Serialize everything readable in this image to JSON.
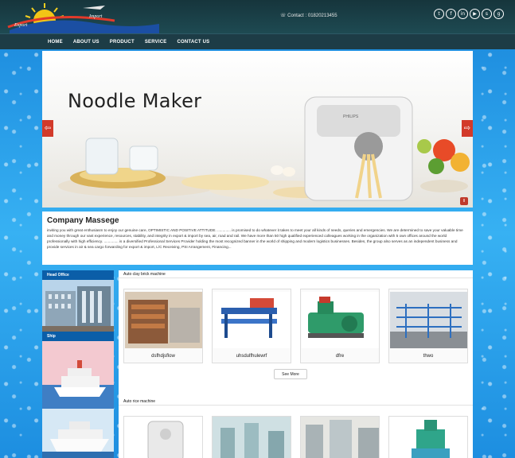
{
  "header": {
    "logo_text_left": "Export",
    "logo_text_right": "Import",
    "contact": "Contact : 01820213455",
    "social_icons": [
      "twitter-icon",
      "facebook-icon",
      "linkedin-icon",
      "youtube-icon",
      "skype-icon",
      "google-plus-icon"
    ],
    "social_glyphs": [
      "t",
      "f",
      "in",
      "▶",
      "s",
      "g"
    ]
  },
  "nav": {
    "items": [
      "HOME",
      "ABOUT US",
      "PRODUCT",
      "SERVICE",
      "CONTACT US"
    ]
  },
  "slider": {
    "title": "Noodle Maker",
    "prev": "⇦",
    "next": "⇨",
    "pause": "II"
  },
  "company": {
    "title": "Company Massege",
    "text": "inviting you with great enthusiasm to enjoy our genuine care, OPTIMISTIC AND POSITIVE ATTITUDE. ............. is promised to do whatever it takes to meet your all kinds of needs, queries and emergencies. We are determined to save your valuable time and money through our vast experience, resources, stability, and integrity in export & import by sea, air, road and rail. We have more than 50 high qualified experienced colleagues working in the organization with 5 own offices around the world professionally with high efficiency. .............. is a diversified Professional Services Provider holding the most recognized banner in the world of shipping and modern logistics businesses. Besides, the group also serves as an independent business and provide services in air & sea cargo forwarding for export & import, L/C Receiving, PSI Arrangement, Financing..."
  },
  "sidebar": {
    "items": [
      "Head Office",
      "Ship"
    ]
  },
  "sections": [
    {
      "title": "Auto clay brick machine",
      "products": [
        "dsfhdjsflow",
        "uhsdulfhulewrf",
        "dfre",
        "thwo"
      ],
      "see_more": "See More"
    },
    {
      "title": "Auto rice machine"
    }
  ],
  "colors": {
    "header": "#1e4a52",
    "nav": "#1d3c46",
    "accent_red": "#d23a2a",
    "sidebar_head": "#0b5ea8"
  }
}
